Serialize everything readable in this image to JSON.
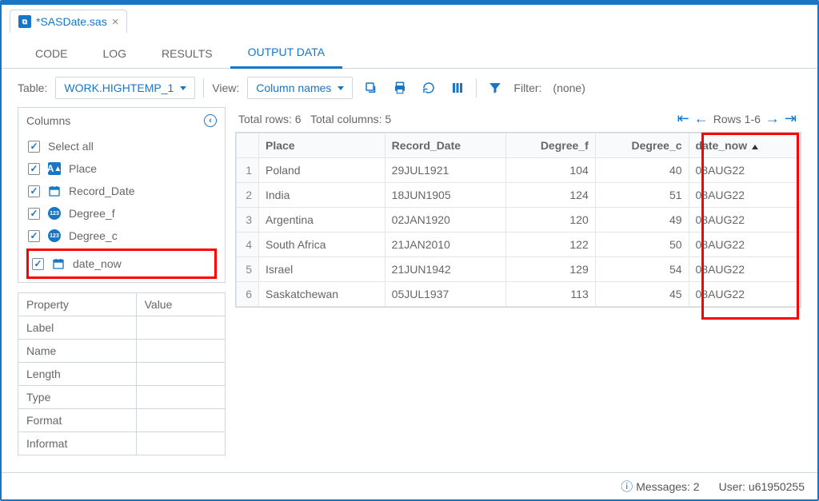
{
  "file_tab": "*SASDate.sas",
  "tabs": {
    "code": "CODE",
    "log": "LOG",
    "results": "RESULTS",
    "output_data": "OUTPUT DATA"
  },
  "toolbar": {
    "table_label": "Table:",
    "table_value": "WORK.HIGHTEMP_1",
    "view_label": "View:",
    "view_value": "Column names",
    "filter_label": "Filter:",
    "filter_value": "(none)"
  },
  "columns": {
    "header": "Columns",
    "select_all": "Select all",
    "items": [
      {
        "label": "Place",
        "type": "alpha"
      },
      {
        "label": "Record_Date",
        "type": "date"
      },
      {
        "label": "Degree_f",
        "type": "num"
      },
      {
        "label": "Degree_c",
        "type": "num"
      },
      {
        "label": "date_now",
        "type": "date"
      }
    ]
  },
  "props": {
    "h_property": "Property",
    "h_value": "Value",
    "rows": [
      "Label",
      "Name",
      "Length",
      "Type",
      "Format",
      "Informat"
    ]
  },
  "table_status": {
    "total_rows": "Total rows: 6",
    "total_cols": "Total columns: 5",
    "rows_range": "Rows 1-6"
  },
  "data": {
    "headers": [
      "Place",
      "Record_Date",
      "Degree_f",
      "Degree_c",
      "date_now"
    ],
    "rows": [
      {
        "n": "1",
        "place": "Poland",
        "rdate": "29JUL1921",
        "f": "104",
        "c": "40",
        "dn": "08AUG22"
      },
      {
        "n": "2",
        "place": "India",
        "rdate": "18JUN1905",
        "f": "124",
        "c": "51",
        "dn": "08AUG22"
      },
      {
        "n": "3",
        "place": "Argentina",
        "rdate": "02JAN1920",
        "f": "120",
        "c": "49",
        "dn": "08AUG22"
      },
      {
        "n": "4",
        "place": "South Africa",
        "rdate": "21JAN2010",
        "f": "122",
        "c": "50",
        "dn": "08AUG22"
      },
      {
        "n": "5",
        "place": "Israel",
        "rdate": "21JUN1942",
        "f": "129",
        "c": "54",
        "dn": "08AUG22"
      },
      {
        "n": "6",
        "place": "Saskatchewan",
        "rdate": "05JUL1937",
        "f": "113",
        "c": "45",
        "dn": "08AUG22"
      }
    ]
  },
  "status_bar": {
    "messages": "Messages: 2",
    "user_lbl": "User:",
    "user_val": "u61950255"
  }
}
